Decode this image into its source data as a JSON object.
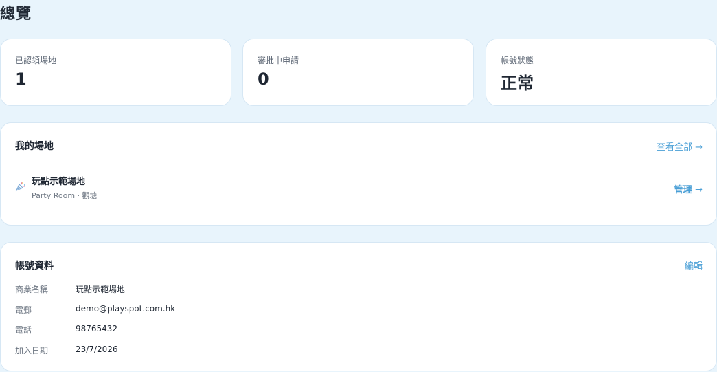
{
  "page": {
    "title": "總覽"
  },
  "stats": [
    {
      "label": "已認領場地",
      "value": "1"
    },
    {
      "label": "審批中申請",
      "value": "0"
    },
    {
      "label": "帳號狀態",
      "value": "正常"
    }
  ],
  "venues_section": {
    "title": "我的場地",
    "view_all_label": "查看全部 →",
    "items": [
      {
        "icon": "party-popper-icon",
        "name": "玩點示範場地",
        "meta": "Party Room · 觀塘",
        "manage_label": "管理 →"
      }
    ]
  },
  "profile_section": {
    "title": "帳號資料",
    "edit_label": "編輯",
    "fields": [
      {
        "label": "商業名稱",
        "value": "玩點示範場地"
      },
      {
        "label": "電郵",
        "value": "demo@playspot.com.hk"
      },
      {
        "label": "電話",
        "value": "98765432"
      },
      {
        "label": "加入日期",
        "value": "23/7/2026"
      }
    ]
  },
  "colors": {
    "background": "#e8f4fc",
    "card": "#ffffff",
    "accent": "#4a9fd6",
    "text": "#1f2733",
    "muted": "#6b7480"
  }
}
